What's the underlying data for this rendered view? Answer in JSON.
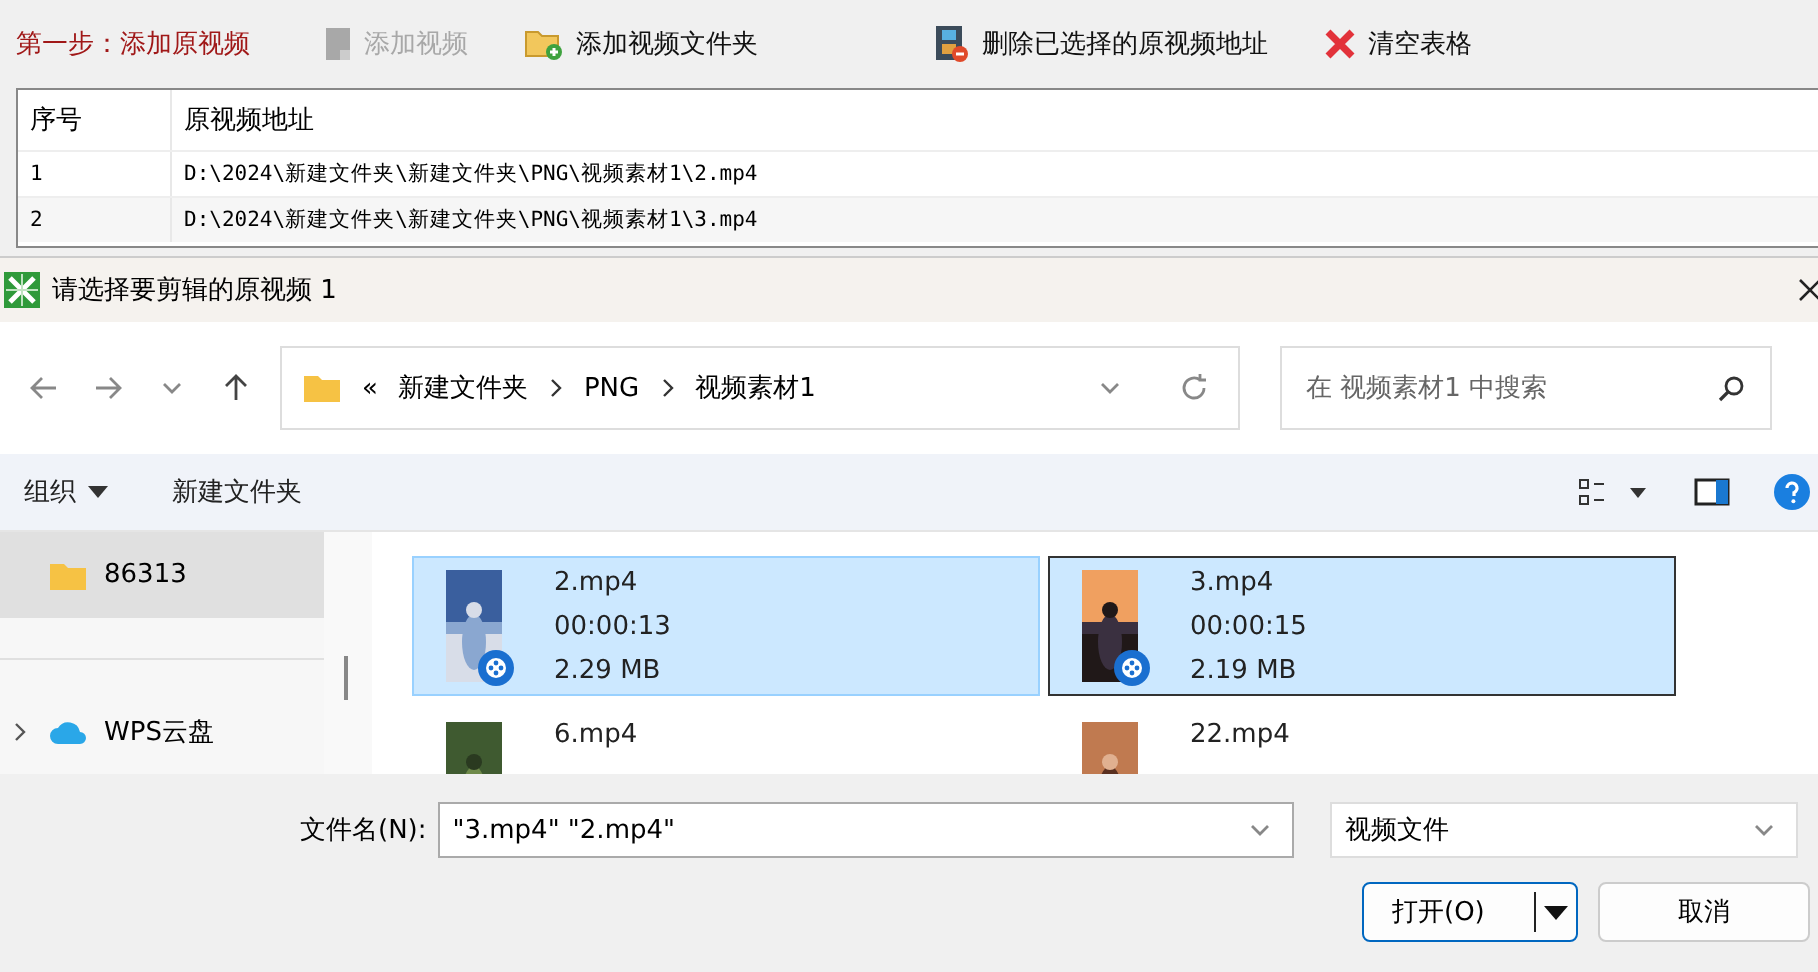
{
  "toolbar": {
    "step_label": "第一步：添加原视频",
    "buttons": [
      {
        "kind": "video",
        "label": "添加视频",
        "disabled": true
      },
      {
        "kind": "folder",
        "label": "添加视频文件夹",
        "disabled": false
      },
      {
        "kind": "film",
        "label": "删除已选择的原视频地址",
        "disabled": false
      },
      {
        "kind": "clear",
        "label": "清空表格",
        "disabled": false
      }
    ]
  },
  "table": {
    "columns": [
      "序号",
      "原视频地址"
    ],
    "rows": [
      {
        "cells": [
          "1",
          "D:\\2024\\新建文件夹\\新建文件夹\\PNG\\视频素材1\\2.mp4"
        ]
      },
      {
        "cells": [
          "2",
          "D:\\2024\\新建文件夹\\新建文件夹\\PNG\\视频素材1\\3.mp4"
        ]
      }
    ]
  },
  "dialog": {
    "title": "请选择要剪辑的原视频 1",
    "address": {
      "overflow": "«",
      "crumbs": [
        "新建文件夹",
        "PNG",
        "视频素材1"
      ]
    },
    "search": {
      "placeholder": "在 视频素材1 中搜索"
    },
    "commands": {
      "organize": "组织",
      "new_folder": "新建文件夹"
    },
    "sidebar": {
      "items": [
        {
          "kind": "folder",
          "label": "86313",
          "selected": true
        },
        {
          "kind": "cloud",
          "label": "WPS云盘",
          "selected": false
        }
      ]
    },
    "files": [
      {
        "name": "2.mp4",
        "duration": "00:00:13",
        "size": "2.29 MB",
        "selected": true,
        "focused": false
      },
      {
        "name": "3.mp4",
        "duration": "00:00:15",
        "size": "2.19 MB",
        "selected": true,
        "focused": true
      },
      {
        "name": "6.mp4",
        "selected": false,
        "focused": false
      },
      {
        "name": "22.mp4",
        "selected": false,
        "focused": false
      }
    ],
    "filename": {
      "label": "文件名(N):",
      "value": "\"3.mp4\" \"2.mp4\""
    },
    "filetype": "视频文件",
    "buttons": {
      "open": "打开(O)",
      "cancel": "取消"
    }
  }
}
